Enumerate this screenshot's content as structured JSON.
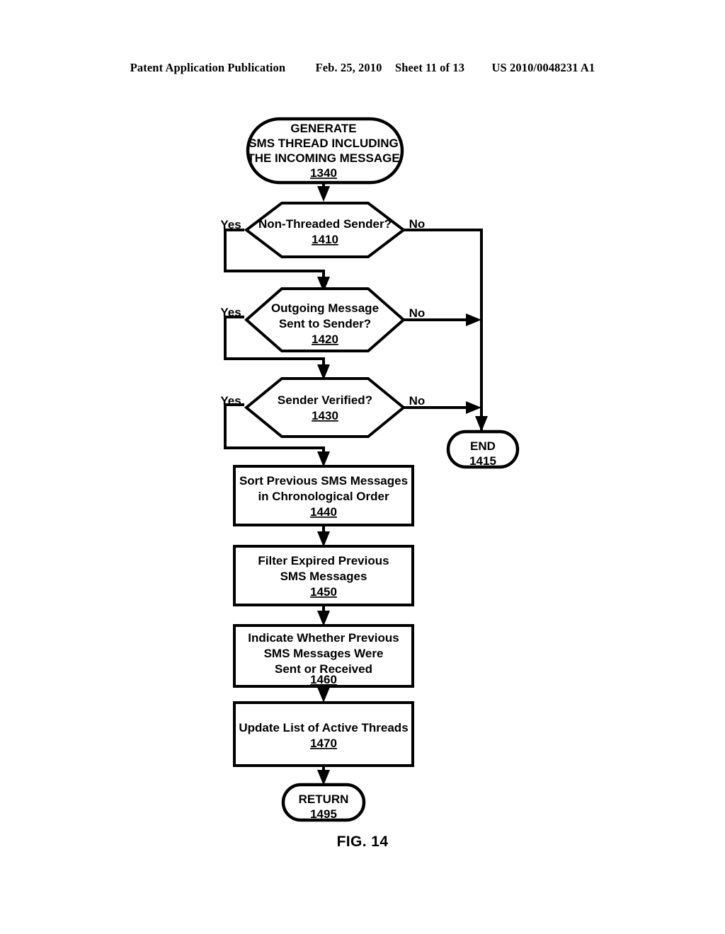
{
  "header": {
    "publication": "Patent Application Publication",
    "date": "Feb. 25, 2010",
    "sheet": "Sheet 11 of 13",
    "patent_number": "US 2010/0048231 A1"
  },
  "figure": {
    "caption": "FIG. 14",
    "line_color": "#000000",
    "fill_color": "#ffffff"
  },
  "flowchart": {
    "nodes": {
      "n1340": {
        "type": "terminator",
        "lines": [
          "GENERATE",
          "SMS THREAD INCLUDING",
          "THE INCOMING MESSAGE"
        ],
        "line1": "GENERATE",
        "line2": "SMS THREAD INCLUDING",
        "line3": "THE INCOMING MESSAGE",
        "ref": "1340"
      },
      "n1410": {
        "type": "decision",
        "line1": "Non-Threaded Sender?",
        "ref": "1410",
        "yes_label": "Yes",
        "no_label": "No"
      },
      "n1420": {
        "type": "decision",
        "line1": "Outgoing Message",
        "line2": "Sent to Sender?",
        "ref": "1420",
        "yes_label": "Yes",
        "no_label": "No"
      },
      "n1430": {
        "type": "decision",
        "line1": "Sender Verified?",
        "ref": "1430",
        "yes_label": "Yes",
        "no_label": "No"
      },
      "n1415": {
        "type": "terminator",
        "line1": "END",
        "ref": "1415"
      },
      "n1440": {
        "type": "process",
        "line1": "Sort Previous SMS Messages",
        "line2": "in Chronological Order",
        "ref": "1440"
      },
      "n1450": {
        "type": "process",
        "line1": "Filter Expired Previous",
        "line2": "SMS Messages",
        "ref": "1450"
      },
      "n1460": {
        "type": "process",
        "line1": "Indicate Whether Previous",
        "line2": "SMS Messages Were",
        "line3": "Sent or Received",
        "ref": "1460"
      },
      "n1470": {
        "type": "process",
        "line1": "Update List of Active Threads",
        "ref": "1470"
      },
      "n1495": {
        "type": "terminator",
        "line1": "RETURN",
        "ref": "1495"
      }
    },
    "flow_order": [
      "n1340",
      "n1410",
      "n1420",
      "n1430",
      "n1440",
      "n1450",
      "n1460",
      "n1470",
      "n1495"
    ],
    "edges": [
      {
        "from": "n1340",
        "to": "n1410",
        "label": ""
      },
      {
        "from": "n1410",
        "to": "n1420",
        "label": "Yes"
      },
      {
        "from": "n1410",
        "to": "n1415",
        "label": "No"
      },
      {
        "from": "n1420",
        "to": "n1430",
        "label": "Yes"
      },
      {
        "from": "n1420",
        "to": "n1415",
        "label": "No"
      },
      {
        "from": "n1430",
        "to": "n1440",
        "label": "Yes"
      },
      {
        "from": "n1430",
        "to": "n1415",
        "label": "No"
      },
      {
        "from": "n1440",
        "to": "n1450",
        "label": ""
      },
      {
        "from": "n1450",
        "to": "n1460",
        "label": ""
      },
      {
        "from": "n1460",
        "to": "n1470",
        "label": ""
      },
      {
        "from": "n1470",
        "to": "n1495",
        "label": ""
      }
    ]
  }
}
